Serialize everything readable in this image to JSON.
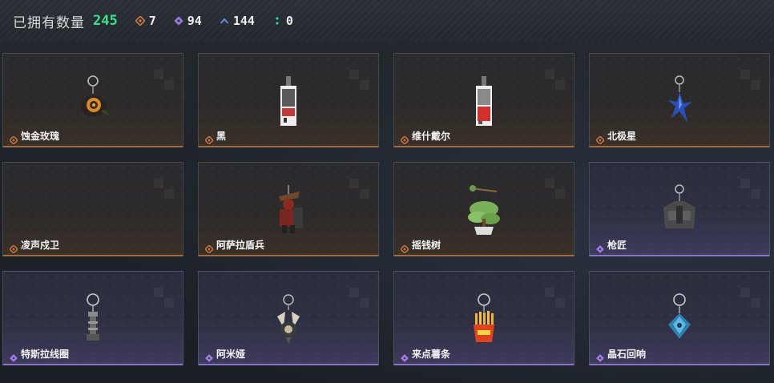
{
  "header": {
    "owned_label": "已拥有数量",
    "owned_count": "245",
    "stats": [
      {
        "icon": "orange-diamond-icon",
        "color": "#d07a45",
        "value": "7"
      },
      {
        "icon": "purple-diamond-icon",
        "color": "#9b7be0",
        "value": "94"
      },
      {
        "icon": "blue-chevron-icon",
        "color": "#5d8fd8",
        "value": "144"
      },
      {
        "icon": "green-dots-icon",
        "color": "#3ad0a0",
        "value": "0"
      }
    ]
  },
  "items": [
    {
      "name": "蚀金玫瑰",
      "rarity": "orange",
      "art": "rose-charm"
    },
    {
      "name": "黑",
      "rarity": "orange",
      "art": "card-charm-dark"
    },
    {
      "name": "维什戴尔",
      "rarity": "orange",
      "art": "card-charm-red"
    },
    {
      "name": "北极星",
      "rarity": "orange",
      "art": "blue-star-charm"
    },
    {
      "name": "凌声戍卫",
      "rarity": "orange",
      "art": "none"
    },
    {
      "name": "阿萨拉盾兵",
      "rarity": "orange",
      "art": "soldier-charm"
    },
    {
      "name": "摇钱树",
      "rarity": "orange",
      "art": "tree-charm"
    },
    {
      "name": "枪匠",
      "rarity": "purple",
      "art": "vest-charm"
    },
    {
      "name": "特斯拉线圈",
      "rarity": "purple",
      "art": "coil-charm"
    },
    {
      "name": "阿米娅",
      "rarity": "purple",
      "art": "bunny-charm"
    },
    {
      "name": "来点薯条",
      "rarity": "purple",
      "art": "fries-charm"
    },
    {
      "name": "晶石回响",
      "rarity": "purple",
      "art": "crystal-charm"
    }
  ],
  "colors": {
    "orange_border": "#a06a44",
    "purple_border": "#8a74c8",
    "owned_count": "#3de08a"
  }
}
